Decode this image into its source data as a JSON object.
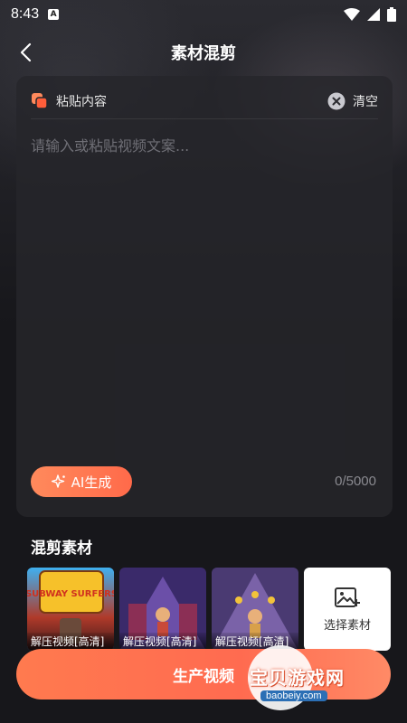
{
  "status_bar": {
    "time": "8:43",
    "a_icon": "A"
  },
  "nav": {
    "title": "素材混剪"
  },
  "editor": {
    "paste_label": "粘贴内容",
    "clear_label": "清空",
    "placeholder": "请输入或粘贴视频文案...",
    "value": "",
    "ai_button_label": "AI生成",
    "counter": "0/5000"
  },
  "materials": {
    "title": "混剪素材",
    "items": [
      {
        "label": "解压视频[高清]",
        "thumb_text": "SUBWAY SURFERS"
      },
      {
        "label": "解压视频[高清]"
      },
      {
        "label": "解压视频[高清]"
      }
    ],
    "select_label": "选择素材"
  },
  "produce_button": {
    "label": "生产视频"
  },
  "watermark": {
    "text": "宝贝游戏网",
    "url": "baobeiy.com"
  },
  "colors": {
    "accent": "#ff6b50",
    "background": "#17171b",
    "card": "#26262b"
  }
}
